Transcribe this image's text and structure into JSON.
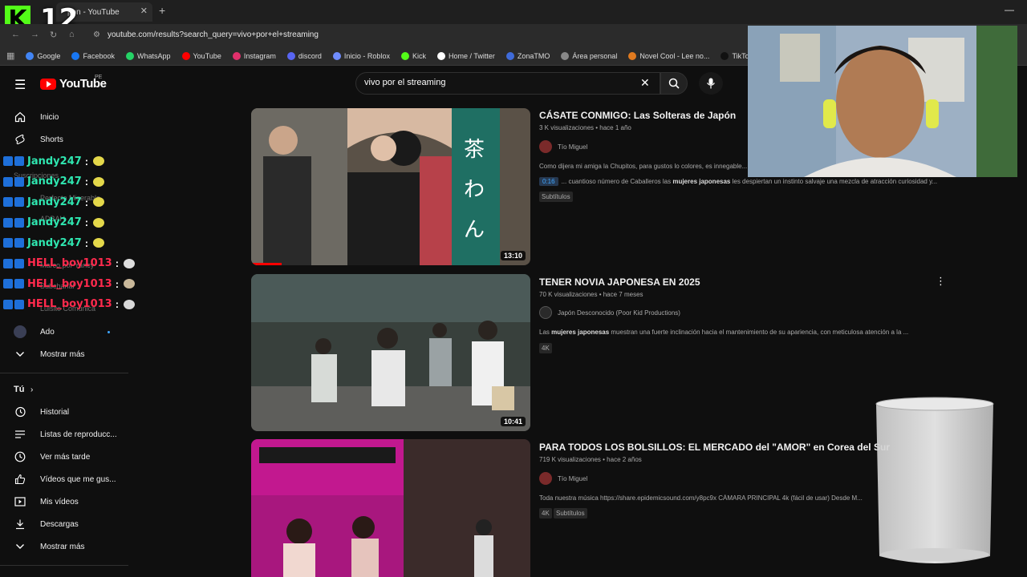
{
  "stream": {
    "overlay_number": "12"
  },
  "browser": {
    "tab_title": "pon - YouTube",
    "url": "youtube.com/results?search_query=vivo+por+el+streaming",
    "bookmarks": [
      {
        "label": "Google",
        "color": "#4285f4"
      },
      {
        "label": "Facebook",
        "color": "#1877f2"
      },
      {
        "label": "WhatsApp",
        "color": "#25d366"
      },
      {
        "label": "YouTube",
        "color": "#ff0000"
      },
      {
        "label": "Instagram",
        "color": "#e1306c"
      },
      {
        "label": "discord",
        "color": "#5865f2"
      },
      {
        "label": "Inicio - Roblox",
        "color": "#6f8cff"
      },
      {
        "label": "Kick",
        "color": "#53fc18"
      },
      {
        "label": "Home / Twitter",
        "color": "#ffffff"
      },
      {
        "label": "ZonaTMO",
        "color": "#3f6bd9"
      },
      {
        "label": "Área personal",
        "color": "#888888"
      },
      {
        "label": "Novel Cool - Lee no...",
        "color": "#e07a1f"
      },
      {
        "label": "TikTok - Alegra tu",
        "color": "#111111"
      }
    ]
  },
  "youtube": {
    "logo_text": "YouTube",
    "region": "PE",
    "search_value": "vivo por el streaming",
    "sidebar": {
      "home": "Inicio",
      "shorts": "Shorts",
      "subscriptions": "Suscripciones",
      "ghost_items": [
        "Perfecto Miserable",
        "ADBAH",
        "Marco por Yancy",
        "Lo mejor",
        "Subchanal",
        "Luisito Comunica"
      ],
      "ado": "Ado",
      "show_more_1": "Mostrar más",
      "you_heading": "Tú",
      "history": "Historial",
      "playlists": "Listas de reproducc...",
      "watch_later": "Ver más tarde",
      "liked": "Vídeos que me gus...",
      "my_videos": "Mis vídeos",
      "downloads": "Descargas",
      "show_more_2": "Mostrar más"
    },
    "results": [
      {
        "title": "CÁSATE CONMIGO: Las Solteras de Japón",
        "meta": "3 K visualizaciones • hace 1 año",
        "channel": "Tío Miguel",
        "description": "Como dijera mi amiga la Chupitos, para gustos lo colores, es innegable...",
        "chapter_time": "0:16",
        "chapter_pre": "... cuantioso número de Caballeros las ",
        "chapter_bold": "mujeres japonesas",
        "chapter_post": " les despiertan un instinto salvaje una mezcla de atracción curiosidad y...",
        "tags": [
          "Subtítulos"
        ],
        "duration": "13:10",
        "progress": 0.11
      },
      {
        "title": "TENER NOVIA JAPONESA EN 2025",
        "meta": "70 K visualizaciones • hace 7 meses",
        "channel": "Japón Desconocido (Poor Kid Productions)",
        "desc_pre": "Las ",
        "desc_bold": "mujeres japonesas",
        "desc_post": " muestran una fuerte inclinación hacia el mantenimiento de su apariencia, con meticulosa atención a la ...",
        "tags": [
          "4K"
        ],
        "duration": "10:41"
      },
      {
        "title": "PARA TODOS LOS BOLSILLOS: EL MERCADO del \"AMOR\" en Corea del Sur",
        "meta": "719 K visualizaciones • hace 2 años",
        "channel": "Tío Miguel",
        "description": "Toda nuestra música https://share.epidemicsound.com/y8pc9x CÁMARA PRINCIPAL 4k (fácil de usar) Desde M...",
        "tags": [
          "4K",
          "Subtítulos"
        ]
      }
    ]
  },
  "chat": [
    {
      "user": "Jandy247",
      "color": "#2fe6b0",
      "emote": "#e4d84a"
    },
    {
      "user": "Jandy247",
      "color": "#2fe6b0",
      "emote": "#e4d84a"
    },
    {
      "user": "Jandy247",
      "color": "#2fe6b0",
      "emote": "#e4d84a"
    },
    {
      "user": "Jandy247",
      "color": "#2fe6b0",
      "emote": "#e4d84a"
    },
    {
      "user": "Jandy247",
      "color": "#2fe6b0",
      "emote": "#e4d84a"
    },
    {
      "user": "HELL_boy1013",
      "color": "#ff2a4d",
      "emote": "#dddddd"
    },
    {
      "user": "HELL_boy1013",
      "color": "#ff2a4d",
      "emote": "#c9b89a"
    },
    {
      "user": "HELL_boy1013",
      "color": "#ff2a4d",
      "emote": "#d8d8d8"
    }
  ]
}
